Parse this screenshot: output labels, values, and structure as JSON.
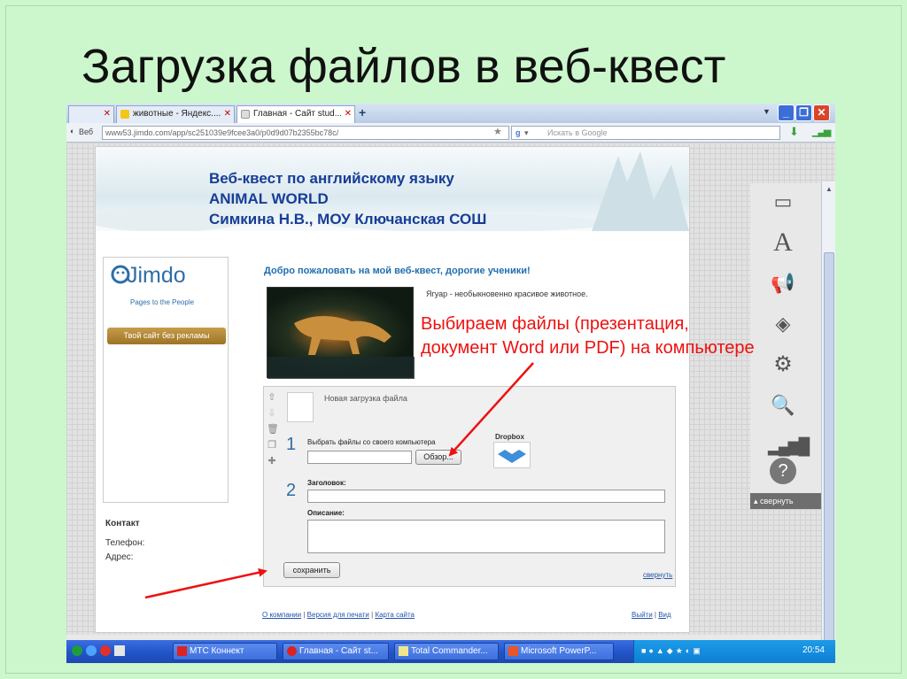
{
  "slide_title": "Загрузка файлов в веб-квест",
  "browser": {
    "tabs": [
      {
        "label": "",
        "active": false
      },
      {
        "label": "животные - Яндекс....",
        "active": false
      },
      {
        "label": "Главная - Сайт stud...",
        "active": true
      }
    ],
    "address_prefix": "Веб",
    "url": "www53.jimdo.com/app/sc251039e9fcee3a0/p0d9d07b2355bc78c/",
    "search_placeholder": "Искать в Google"
  },
  "site": {
    "banner_lines": [
      "Веб-квест по английскому языку",
      "ANIMAL WORLD",
      "Симкина Н.В., МОУ Ключанская СОШ"
    ],
    "logo_text": "Jimdo",
    "logo_subtitle": "Pages to the People",
    "ad_button": "Твой сайт без рекламы",
    "contact_heading": "Контакт",
    "phone_label": "Телефон:",
    "address_label": "Адрес:",
    "welcome": "Добро пожаловать на мой веб-квест, дорогие ученики!",
    "jaguar_caption": "Ягуар - необыкновенно красивое животное.",
    "upload": {
      "new_upload_label": "Новая загрузка файла",
      "step1": "1",
      "choose_label": "Выбрать файлы со своего компьютера",
      "browse_button": "Обзор...",
      "dropbox_label": "Dropbox",
      "step2": "2",
      "heading_label": "Заголовок:",
      "description_label": "Описание:",
      "save_button": "сохранить",
      "collapse_link": "свернуть"
    },
    "footer": {
      "about": "О компании",
      "print": "Версия для печати",
      "sitemap": "Карта сайта",
      "logout": "Выйти",
      "view": "Вид"
    }
  },
  "right_panel": {
    "collapse_label": "свернуть"
  },
  "annotation": {
    "line1": "Выбираем файлы (презентация,",
    "line2": "документ Word или PDF) на компьютере",
    "color": "#e11111"
  },
  "taskbar": {
    "items": [
      "МТС Коннект",
      "Главная - Сайт st...",
      "Total Commander...",
      "Microsoft PowerP..."
    ],
    "clock": "20:54"
  }
}
